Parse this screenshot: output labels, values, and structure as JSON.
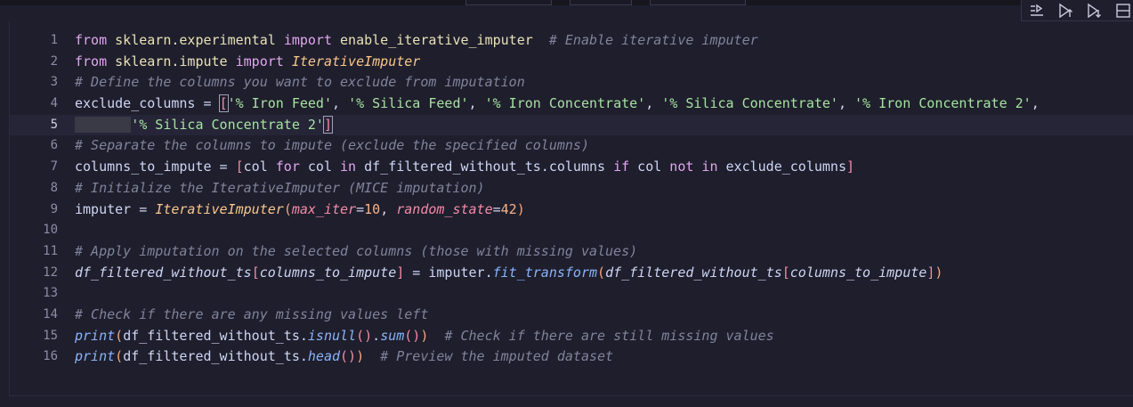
{
  "editor": {
    "lines": [
      {
        "n": "1",
        "tokens": [
          [
            "kw",
            "from"
          ],
          [
            "var",
            " "
          ],
          [
            "mod",
            "sklearn.experimental"
          ],
          [
            "var",
            " "
          ],
          [
            "kw",
            "import"
          ],
          [
            "var",
            " "
          ],
          [
            "mod",
            "enable_iterative_imputer"
          ],
          [
            "var",
            "  "
          ],
          [
            "cm",
            "# Enable iterative imputer"
          ]
        ]
      },
      {
        "n": "2",
        "tokens": [
          [
            "kw",
            "from"
          ],
          [
            "var",
            " "
          ],
          [
            "mod",
            "sklearn.impute"
          ],
          [
            "var",
            " "
          ],
          [
            "kw",
            "import"
          ],
          [
            "var",
            " "
          ],
          [
            "cls",
            "IterativeImputer"
          ]
        ]
      },
      {
        "n": "3",
        "tokens": [
          [
            "cm",
            "# Define the columns you want to exclude from imputation"
          ]
        ]
      },
      {
        "n": "4",
        "tokens": [
          [
            "var",
            "exclude_columns = "
          ],
          [
            "p2",
            "["
          ],
          [
            "str",
            "'% Iron Feed'"
          ],
          [
            "var",
            ", "
          ],
          [
            "str",
            "'% Silica Feed'"
          ],
          [
            "var",
            ", "
          ],
          [
            "str",
            "'% Iron Concentrate'"
          ],
          [
            "var",
            ", "
          ],
          [
            "str",
            "'% Silica Concentrate'"
          ],
          [
            "var",
            ", "
          ],
          [
            "str",
            "'% Iron Concentrate 2'"
          ],
          [
            "var",
            ","
          ]
        ]
      },
      {
        "n": "5",
        "tokens": [
          [
            "indent",
            "       "
          ],
          [
            "str",
            "'% Silica Concentrate 2'"
          ],
          [
            "p2",
            "]"
          ]
        ]
      },
      {
        "n": "6",
        "tokens": [
          [
            "cm",
            "# Separate the columns to impute (exclude the specified columns)"
          ]
        ]
      },
      {
        "n": "7",
        "tokens": [
          [
            "var",
            "columns_to_impute = "
          ],
          [
            "p2",
            "["
          ],
          [
            "var",
            "col "
          ],
          [
            "kw",
            "for"
          ],
          [
            "var",
            " col "
          ],
          [
            "kw",
            "in"
          ],
          [
            "var",
            " df_filtered_without_ts.columns "
          ],
          [
            "kw",
            "if"
          ],
          [
            "var",
            " col "
          ],
          [
            "kw",
            "not in"
          ],
          [
            "var",
            " exclude_columns"
          ],
          [
            "p2",
            "]"
          ]
        ]
      },
      {
        "n": "8",
        "tokens": [
          [
            "cm",
            "# Initialize the IterativeImputer (MICE imputation)"
          ]
        ]
      },
      {
        "n": "9",
        "tokens": [
          [
            "var",
            "imputer = "
          ],
          [
            "cls",
            "IterativeImputer"
          ],
          [
            "p1",
            "("
          ],
          [
            "par",
            "max_iter"
          ],
          [
            "var",
            "="
          ],
          [
            "num",
            "10"
          ],
          [
            "var",
            ", "
          ],
          [
            "par",
            "random_state"
          ],
          [
            "var",
            "="
          ],
          [
            "num",
            "42"
          ],
          [
            "p1",
            ")"
          ]
        ]
      },
      {
        "n": "10",
        "tokens": []
      },
      {
        "n": "11",
        "tokens": [
          [
            "cm",
            "# Apply imputation on the selected columns (those with missing values)"
          ]
        ]
      },
      {
        "n": "12",
        "tokens": [
          [
            "ivar",
            "df_filtered_without_ts"
          ],
          [
            "p2",
            "["
          ],
          [
            "ivar",
            "columns_to_impute"
          ],
          [
            "p2",
            "]"
          ],
          [
            "var",
            " = imputer."
          ],
          [
            "fn",
            "fit_transform"
          ],
          [
            "p1",
            "("
          ],
          [
            "ivar",
            "df_filtered_without_ts"
          ],
          [
            "p2",
            "["
          ],
          [
            "ivar",
            "columns_to_impute"
          ],
          [
            "p2",
            "]"
          ],
          [
            "p1",
            ")"
          ]
        ]
      },
      {
        "n": "13",
        "tokens": []
      },
      {
        "n": "14",
        "tokens": [
          [
            "cm",
            "# Check if there are any missing values left"
          ]
        ]
      },
      {
        "n": "15",
        "tokens": [
          [
            "fn",
            "print"
          ],
          [
            "p1",
            "("
          ],
          [
            "var",
            "df_filtered_without_ts."
          ],
          [
            "fn",
            "isnull"
          ],
          [
            "p2",
            "()"
          ],
          [
            "var",
            "."
          ],
          [
            "fn",
            "sum"
          ],
          [
            "p2",
            "()"
          ],
          [
            "p1",
            ")"
          ],
          [
            "var",
            "  "
          ],
          [
            "cm",
            "# Check if there are still missing values"
          ]
        ]
      },
      {
        "n": "16",
        "tokens": [
          [
            "fn",
            "print"
          ],
          [
            "p1",
            "("
          ],
          [
            "var",
            "df_filtered_without_ts."
          ],
          [
            "fn",
            "head"
          ],
          [
            "p2",
            "()"
          ],
          [
            "p1",
            ")"
          ],
          [
            "var",
            "  "
          ],
          [
            "cm",
            "# Preview the imputed dataset"
          ]
        ]
      }
    ],
    "active_line": "5"
  },
  "toolbar": {
    "icons": [
      "run-by-line-icon",
      "execute-above-icon",
      "execute-below-icon",
      "split-cell-icon"
    ]
  }
}
